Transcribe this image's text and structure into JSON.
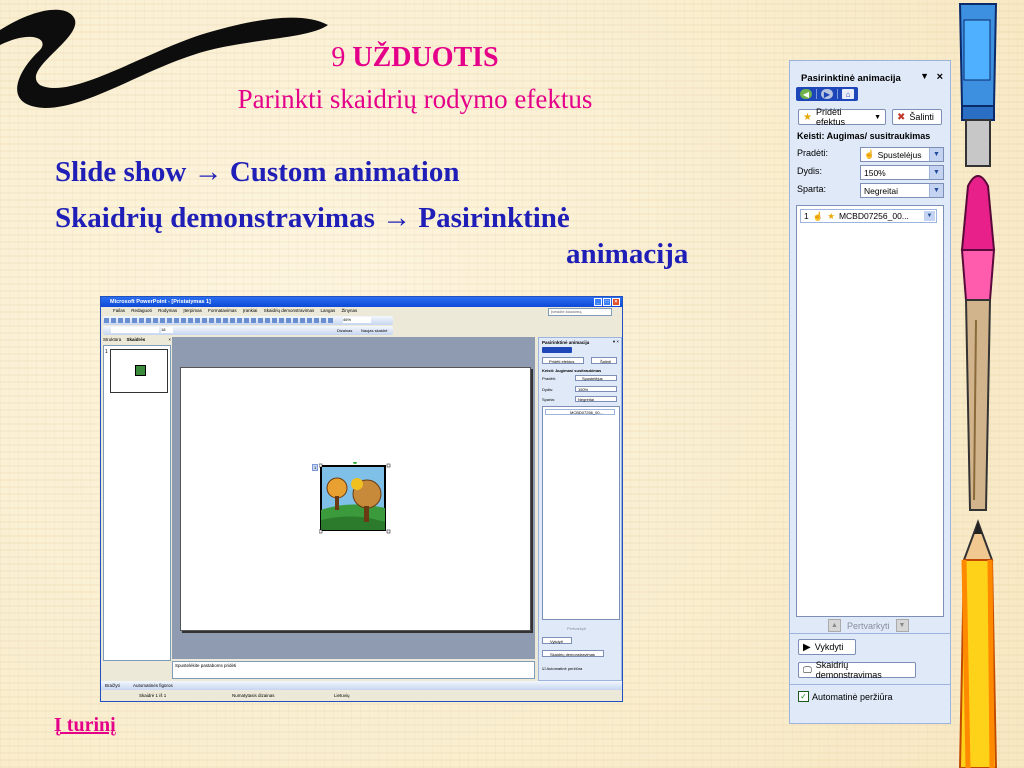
{
  "slide": {
    "title_number": "9",
    "title_word": "UŽDUOTIS",
    "subtitle": "Parinkti skaidrių rodymo efektus",
    "line1": "Slide show → Custom animation",
    "line2": "Skaidrių demonstravimas → Pasirinktinė",
    "line3": "animacija",
    "link": "Į turinį"
  },
  "pane": {
    "title": "Pasirinktinė animacija",
    "dropdown_glyph": "▼",
    "close_glyph": "×",
    "add_effect": "Pridėti efektus",
    "remove": "Šalinti",
    "modify_heading": "Keisti: Augimas/ susitraukimas",
    "start_label": "Pradėti:",
    "start_value": "Spustelėjus",
    "size_label": "Dydis:",
    "size_value": "150%",
    "speed_label": "Sparta:",
    "speed_value": "Negreitai",
    "list_number": "1",
    "list_item": "MCBD07256_00...",
    "reorder": "Pertvarkyti",
    "play": "Vykdyti",
    "slideshow": "Skaidrių demonstravimas",
    "autopreview": "Automatinė peržiūra"
  },
  "ppt": {
    "title": "Microsoft PowerPoint - [Pristatymas 1]",
    "menu": [
      "Failas",
      "Redaguoti",
      "Rodymas",
      "Įterpimas",
      "Formatavimas",
      "Įrankiai",
      "Skaidrių demonstravimas",
      "Langas",
      "Žinynas"
    ],
    "search": "Įveskite klausimą",
    "zoom": "46%",
    "font_size": "18",
    "toolbar_design": "Dizainas",
    "toolbar_new_slide": "Naujas skaidrė",
    "tab_outline": "Struktūra",
    "tab_slides": "Skaidrės",
    "thumb_number": "1",
    "notes": "Spustelėkite pastaboms pridėti",
    "draw": "Braižyti",
    "autoshapes": "Automatinės figūros",
    "status_slide": "Skaidrė 1 iš 1",
    "status_design": "Numatytasis dizainas",
    "status_lang": "Lietuvių",
    "pane_title": "Pasirinktinė animacija",
    "pane_add": "Pridėti efektus",
    "pane_remove": "Šalinti",
    "pane_heading": "Keisti: Augimas/ susitraukimas",
    "pane_start_label": "Pradėti:",
    "pane_start": "Spustelėjus",
    "pane_size_label": "Dydis:",
    "pane_size": "150%",
    "pane_speed_label": "Sparta:",
    "pane_speed": "Negreitai",
    "pane_item": "MCBD07256_00...",
    "pane_reorder": "Pertvarkyti",
    "pane_play": "Vykdyti",
    "pane_slideshow": "Skaidrių demonstravimas",
    "pane_auto": "Automatinė peržiūra",
    "anim_tag": "1"
  },
  "colors": {
    "title_pink": "#e5008a",
    "menu_blue": "#1f1fb8",
    "pane_bg": "#dfe9f8",
    "xp_blue": "#0d48d6"
  },
  "icons": [
    "brush-stroke",
    "star-icon",
    "eraser-icon",
    "cursor-icon",
    "play-icon",
    "slideshow-icon",
    "pencil",
    "paintbrush",
    "marker"
  ]
}
